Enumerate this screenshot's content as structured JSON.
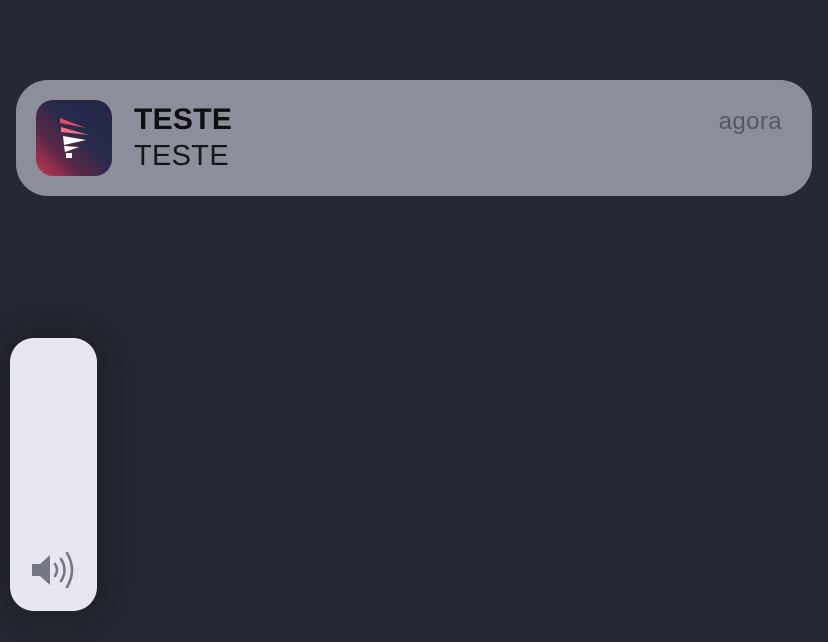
{
  "notification": {
    "app_icon": "pipefy-logo-icon",
    "title": "TESTE",
    "body": "TESTE",
    "time": "agora"
  },
  "volume": {
    "icon": "speaker-volume-icon",
    "level": 0
  },
  "colors": {
    "background": "#262833",
    "notification_bg": "#8c8e99",
    "hud_bg": "#e6e7f1",
    "icon_gradient_start": "#c8364f",
    "icon_gradient_end": "#232647"
  }
}
